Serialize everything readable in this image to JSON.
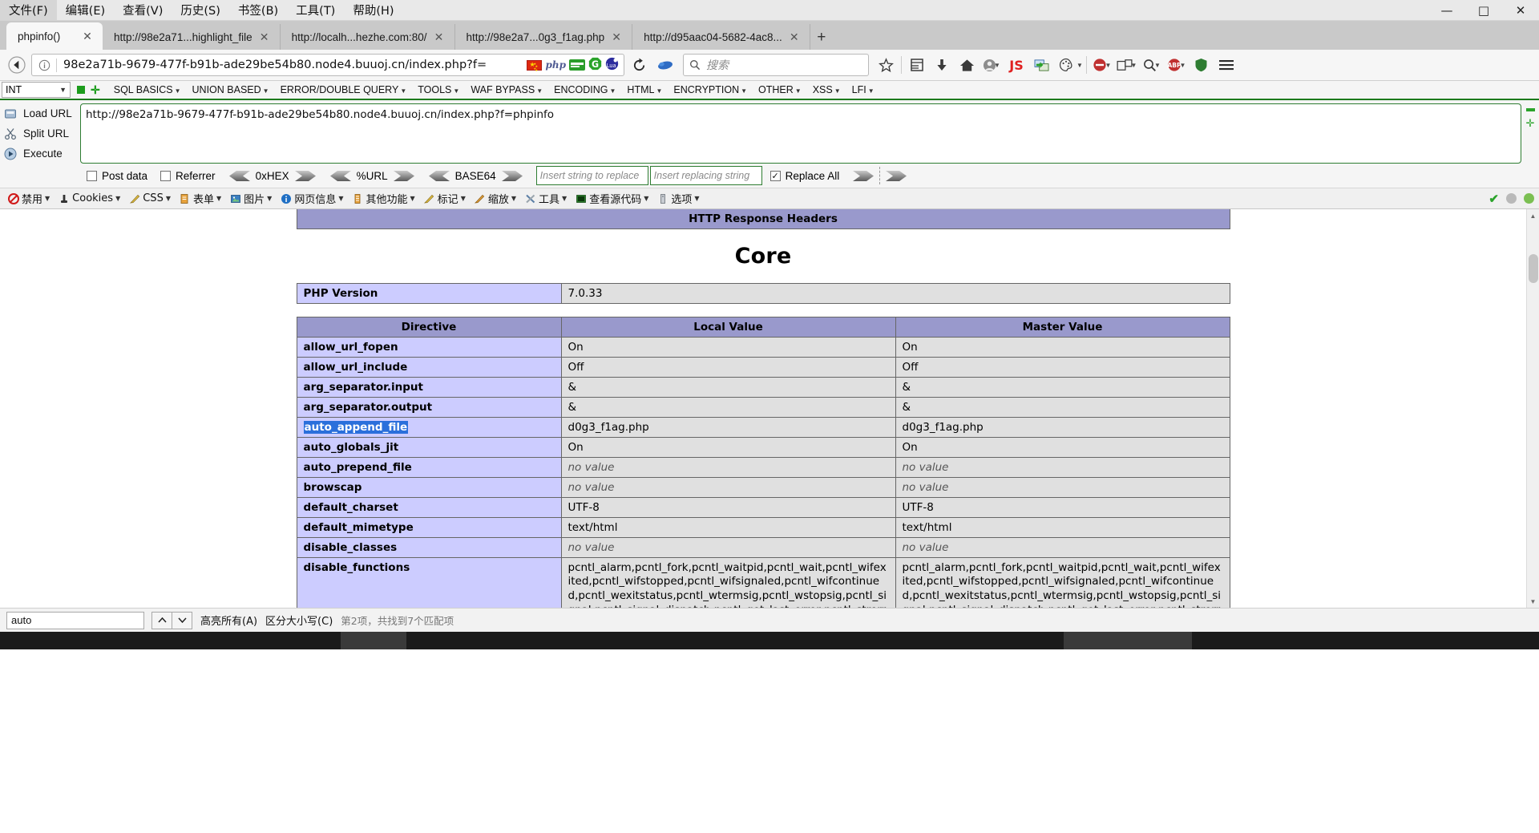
{
  "window": {
    "menus": [
      "文件(F)",
      "编辑(E)",
      "查看(V)",
      "历史(S)",
      "书签(B)",
      "工具(T)",
      "帮助(H)"
    ],
    "minimize": "—",
    "maximize": "□",
    "close": "✕"
  },
  "tabs": [
    {
      "label": "phpinfo()",
      "active": true
    },
    {
      "label": "http://98e2a71...highlight_file",
      "active": false
    },
    {
      "label": "http://localh...hezhe.com:80/",
      "active": false
    },
    {
      "label": "http://98e2a7...0g3_f1ag.php",
      "active": false
    },
    {
      "label": "http://d95aac04-5682-4ac8...",
      "active": false
    }
  ],
  "newtab_label": "+",
  "nav": {
    "back_icon": "back-arrow",
    "site_info_icon": "info-circle",
    "url": "98e2a71b-9679-477f-b91b-ade29be54b80.node4.buuoj.cn/index.php?f=",
    "reload_icon": "reload",
    "search_placeholder": "搜索",
    "inline_icons": [
      "flag-cn",
      "php",
      "greenmark",
      "g-shield",
      "lua"
    ],
    "right_icons": [
      "bookmark-star",
      "library",
      "downloads",
      "home",
      "account",
      "js",
      "screenshot",
      "palette",
      "chevron-down",
      "adblock",
      "container",
      "zoom",
      "abp",
      "shield",
      "hamburger-menu"
    ]
  },
  "hackbar": {
    "type_select": "INT",
    "menus": [
      "SQL BASICS",
      "UNION BASED",
      "ERROR/DOUBLE QUERY",
      "TOOLS",
      "WAF BYPASS",
      "ENCODING",
      "HTML",
      "ENCRYPTION",
      "OTHER",
      "XSS",
      "LFI"
    ],
    "actions": [
      {
        "label": "Load URL",
        "icon": "load-url-icon"
      },
      {
        "label": "Split URL",
        "icon": "split-url-icon"
      },
      {
        "label": "Execute",
        "icon": "execute-icon"
      }
    ],
    "url_textarea": "http://98e2a71b-9679-477f-b91b-ade29be54b80.node4.buuoj.cn/index.php?f=phpinfo",
    "options": {
      "post_data": {
        "label": "Post data",
        "checked": false
      },
      "referrer": {
        "label": "Referrer",
        "checked": false
      },
      "encoders": [
        "0xHEX",
        "%URL",
        "BASE64"
      ],
      "replace_from_placeholder": "Insert string to replace",
      "replace_to_placeholder": "Insert replacing string",
      "replace_all": {
        "label": "Replace All",
        "checked": true
      }
    }
  },
  "toolbar2": {
    "items": [
      {
        "label": "禁用",
        "icon": "disable-icon"
      },
      {
        "label": "Cookies",
        "icon": "cookies-icon"
      },
      {
        "label": "CSS",
        "icon": "css-icon"
      },
      {
        "label": "表单",
        "icon": "forms-icon"
      },
      {
        "label": "图片",
        "icon": "images-icon"
      },
      {
        "label": "网页信息",
        "icon": "information-icon"
      },
      {
        "label": "其他功能",
        "icon": "misc-icon"
      },
      {
        "label": "标记",
        "icon": "outline-icon"
      },
      {
        "label": "缩放",
        "icon": "resize-icon"
      },
      {
        "label": "工具",
        "icon": "tools-icon"
      },
      {
        "label": "查看源代码",
        "icon": "view-source-icon"
      },
      {
        "label": "选项",
        "icon": "options-icon"
      }
    ]
  },
  "page": {
    "http_response_headers": "HTTP Response Headers",
    "core_title": "Core",
    "php_version_label": "PHP Version",
    "php_version_value": "7.0.33",
    "columns": [
      "Directive",
      "Local Value",
      "Master Value"
    ],
    "rows": [
      {
        "directive": "allow_url_fopen",
        "local": "On",
        "master": "On",
        "novalue": false
      },
      {
        "directive": "allow_url_include",
        "local": "Off",
        "master": "Off",
        "novalue": false
      },
      {
        "directive": "arg_separator.input",
        "local": "&",
        "master": "&",
        "novalue": false
      },
      {
        "directive": "arg_separator.output",
        "local": "&",
        "master": "&",
        "novalue": false
      },
      {
        "directive": "auto_append_file",
        "local": "d0g3_f1ag.php",
        "master": "d0g3_f1ag.php",
        "novalue": false,
        "highlight": true
      },
      {
        "directive": "auto_globals_jit",
        "local": "On",
        "master": "On",
        "novalue": false
      },
      {
        "directive": "auto_prepend_file",
        "local": "no value",
        "master": "no value",
        "novalue": true
      },
      {
        "directive": "browscap",
        "local": "no value",
        "master": "no value",
        "novalue": true
      },
      {
        "directive": "default_charset",
        "local": "UTF-8",
        "master": "UTF-8",
        "novalue": false
      },
      {
        "directive": "default_mimetype",
        "local": "text/html",
        "master": "text/html",
        "novalue": false
      },
      {
        "directive": "disable_classes",
        "local": "no value",
        "master": "no value",
        "novalue": true
      },
      {
        "directive": "disable_functions",
        "local": "pcntl_alarm,pcntl_fork,pcntl_waitpid,pcntl_wait,pcntl_wifexited,pcntl_wifstopped,pcntl_wifsignaled,pcntl_wifcontinued,pcntl_wexitstatus,pcntl_wtermsig,pcntl_wstopsig,pcntl_signal,pcntl_signal_dispatch,pcntl_get_last_error,pcntl_strerror,pcntl_sigprocmask,pcntl_sigwaitinfo,pcntl_sigtimedwait,pcntl_exec,pcntl_getpriority,pcntl_setpriority",
        "master": "pcntl_alarm,pcntl_fork,pcntl_waitpid,pcntl_wait,pcntl_wifexited,pcntl_wifstopped,pcntl_wifsignaled,pcntl_wifcontinued,pcntl_wexitstatus,pcntl_wtermsig,pcntl_wstopsig,pcntl_signal,pcntl_signal_dispatch,pcntl_get_last_error,pcntl_strerror,pcntl_sigprocmask,pcntl_sigwaitinfo,pcntl_sigtimedwait,pcntl_exec,pcntl_getpriority,pcntl_setpriority",
        "novalue": false,
        "long": true
      }
    ]
  },
  "findbar": {
    "query": "auto",
    "prev_icon": "chevron-up-icon",
    "next_icon": "chevron-down-icon",
    "highlight_all": "高亮所有(A)",
    "match_case": "区分大小写(C)",
    "status": "第2项，共找到7个匹配项"
  },
  "colors": {
    "table_header": "#9999cc",
    "directive_cell": "#ccccff",
    "value_cell": "#e0e0e0",
    "hackbar_green": "#2e7d32",
    "highlight_blue": "#2a6fdb"
  }
}
